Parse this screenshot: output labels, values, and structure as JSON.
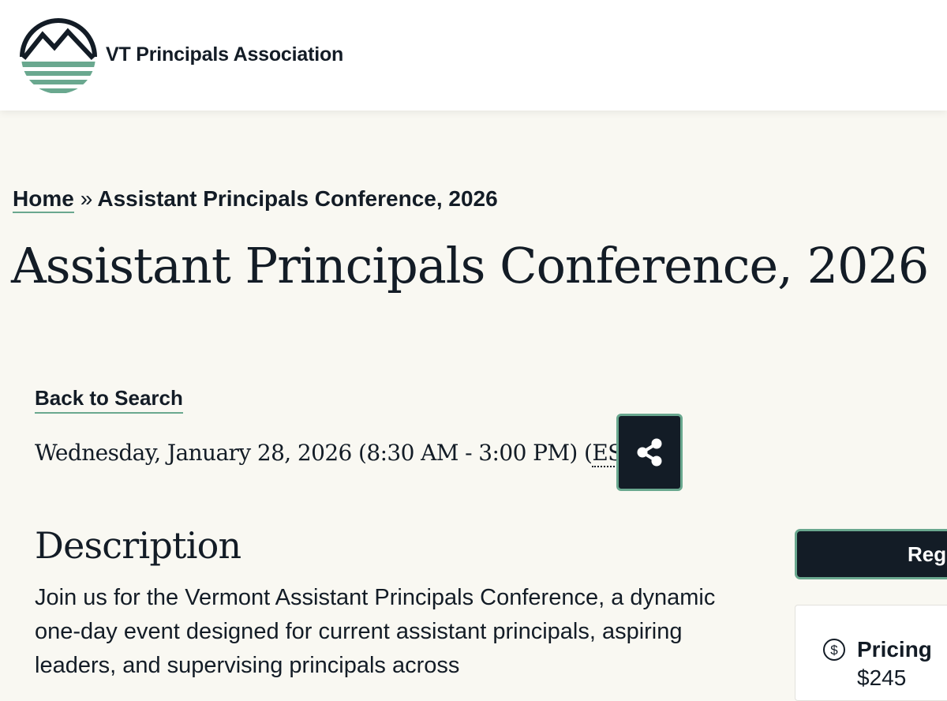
{
  "header": {
    "org_name": "VT Principals Association",
    "logo_icon": "mountain-sun-logo-icon",
    "brand_colors": {
      "dark": "#131c26",
      "accent": "#6aa88f"
    }
  },
  "breadcrumb": {
    "home": "Home",
    "separator": "»",
    "current": "Assistant Principals Conference, 2026"
  },
  "page": {
    "title": "Assistant Principals Conference, 2026",
    "back_link": "Back to Search"
  },
  "event": {
    "date_text": "Wednesday, January 28, 2026 (8:30 AM - 3:00 PM) (",
    "timezone": "EST",
    "date_suffix": ")",
    "share_icon": "share-icon"
  },
  "description": {
    "heading": "Description",
    "body": "Join us for the Vermont Assistant Principals Conference, a dynamic one-day event designed for current assistant principals, aspiring leaders, and supervising principals across"
  },
  "sidebar": {
    "register_label": "Regi",
    "pricing_icon": "dollar-circle-icon",
    "pricing_title": "Pricing",
    "pricing_value": "$245"
  }
}
